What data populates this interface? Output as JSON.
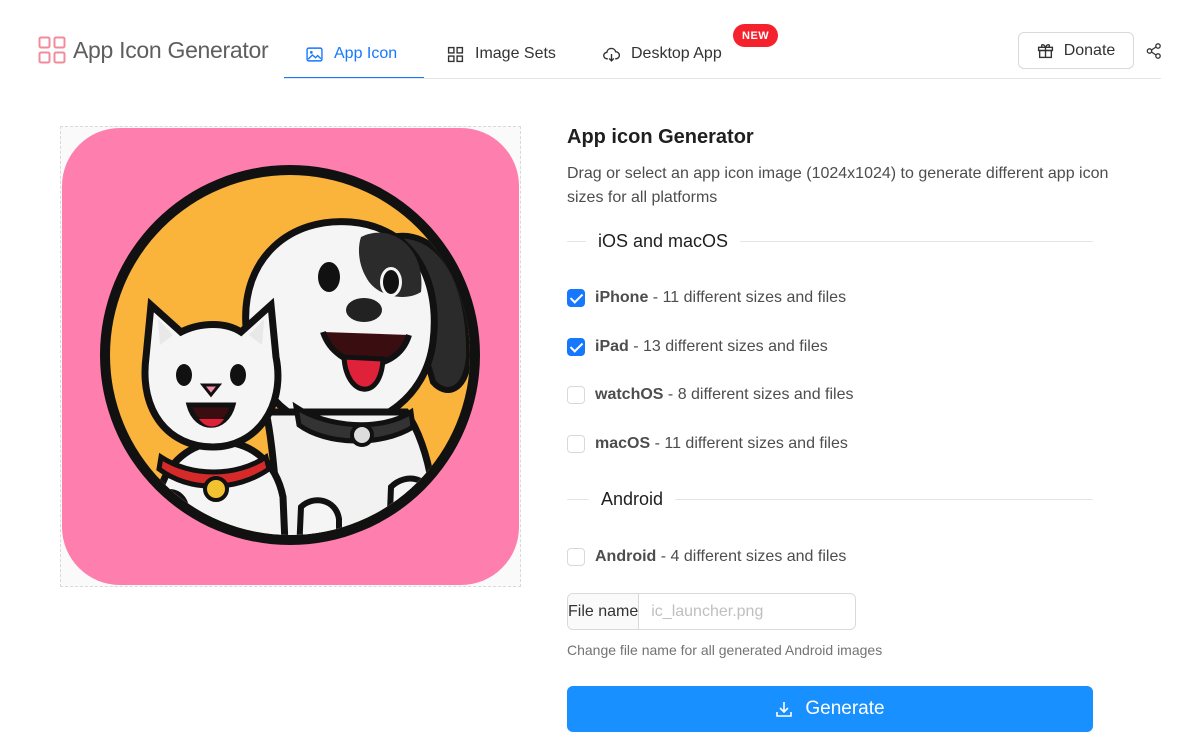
{
  "header": {
    "logo_text": "App Icon Generator",
    "tabs": [
      {
        "label": "App Icon",
        "icon": "image-icon",
        "active": true
      },
      {
        "label": "Image Sets",
        "icon": "grid-icon",
        "active": false
      },
      {
        "label": "Desktop App",
        "icon": "cloud-download-icon",
        "active": false,
        "badge": "NEW"
      }
    ],
    "donate_label": "Donate",
    "share_icon": "share-icon"
  },
  "colors": {
    "accent": "#1677ff",
    "primary_button": "#1890ff",
    "badge": "#f5222d",
    "logo": "#f28b9b",
    "icon_background": "#fe7fae",
    "icon_circle": "#fab33b"
  },
  "main": {
    "title": "App icon Generator",
    "description": "Drag or select an app icon image (1024x1024) to generate different app icon sizes for all platforms",
    "sections": {
      "ios": {
        "label": "iOS and macOS",
        "options": [
          {
            "name": "iPhone",
            "detail": " - 11 different sizes and files",
            "checked": true
          },
          {
            "name": "iPad",
            "detail": " - 13 different sizes and files",
            "checked": true
          },
          {
            "name": "watchOS",
            "detail": " - 8 different sizes and files",
            "checked": false
          },
          {
            "name": "macOS",
            "detail": " - 11 different sizes and files",
            "checked": false
          }
        ]
      },
      "android": {
        "label": "Android",
        "options": [
          {
            "name": "Android",
            "detail": " - 4 different sizes and files",
            "checked": false
          }
        ]
      }
    },
    "file_name": {
      "addon_label": "File name",
      "placeholder": "ic_launcher.png",
      "value": "",
      "help": "Change file name for all generated Android images"
    },
    "generate_label": "Generate"
  }
}
